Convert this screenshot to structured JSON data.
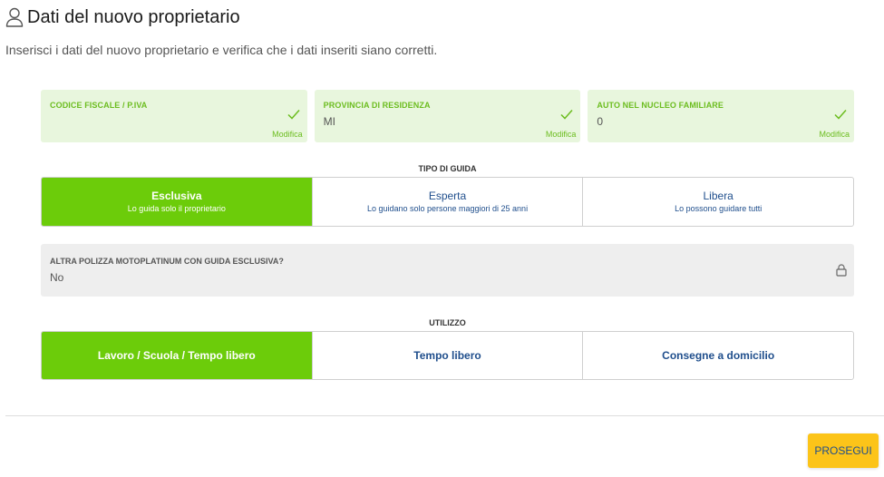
{
  "header": {
    "title": "Dati del nuovo proprietario",
    "subtitle": "Inserisci i dati del nuovo proprietario e verifica che i dati inseriti siano corretti."
  },
  "summary_cards": [
    {
      "label": "CODICE FISCALE / P.IVA",
      "value": "",
      "edit_label": "Modifica",
      "status_icon": "check-icon"
    },
    {
      "label": "PROVINCIA DI RESIDENZA",
      "value": "MI",
      "edit_label": "Modifica",
      "status_icon": "check-icon"
    },
    {
      "label": "AUTO NEL NUCLEO FAMILIARE",
      "value": "0",
      "edit_label": "Modifica",
      "status_icon": "check-icon"
    }
  ],
  "tipo_guida": {
    "label": "TIPO DI GUIDA",
    "selected_index": 0,
    "options": [
      {
        "title": "Esclusiva",
        "description": "Lo guida solo il proprietario"
      },
      {
        "title": "Esperta",
        "description": "Lo guidano solo persone maggiori di 25 anni"
      },
      {
        "title": "Libera",
        "description": "Lo possono guidare tutti"
      }
    ]
  },
  "altra_polizza": {
    "label": "ALTRA POLIZZA MOTOPLATINUM CON GUIDA ESCLUSIVA?",
    "value": "No",
    "icon": "lock-icon"
  },
  "utilizzo": {
    "label": "UTILIZZO",
    "selected_index": 0,
    "options": [
      {
        "title": "Lavoro / Scuola / Tempo libero"
      },
      {
        "title": "Tempo libero"
      },
      {
        "title": "Consegne a domicilio"
      }
    ]
  },
  "actions": {
    "proceed_label": "PROSEGUI"
  },
  "colors": {
    "accent_green": "#6ccc0a",
    "card_bg": "#e8f6dd",
    "card_label": "#6cbd1f",
    "link_blue": "#1f4e8c",
    "button_yellow": "#fcc419",
    "locked_bg": "#eeeeee"
  }
}
